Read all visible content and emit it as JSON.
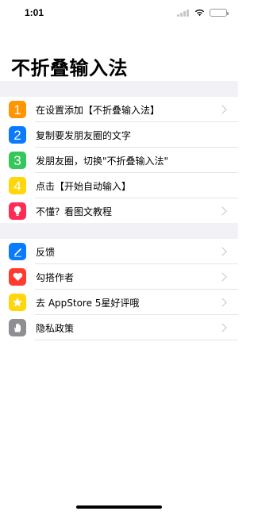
{
  "status": {
    "time": "1:01"
  },
  "title": "不折叠输入法",
  "group1": [
    {
      "num": "1",
      "label": "在设置添加【不折叠输入法】",
      "color": "#ff9500",
      "chevron": true
    },
    {
      "num": "2",
      "label": "复制要发朋友圈的文字",
      "color": "#0a7aff",
      "chevron": false
    },
    {
      "num": "3",
      "label": "发朋友圈，切换\"不折叠输入法\"",
      "color": "#34c759",
      "chevron": false
    },
    {
      "num": "4",
      "label": "点击【开始自动输入】",
      "color": "#ffd60a",
      "chevron": false
    },
    {
      "icon": "lightbulb-icon",
      "label": "不懂？看图文教程",
      "color": "#ff2d55",
      "chevron": true
    }
  ],
  "group2": [
    {
      "icon": "pen-icon",
      "label": "反馈",
      "color": "#0a7aff",
      "chevron": true
    },
    {
      "icon": "heart-icon",
      "label": "勾搭作者",
      "color": "#ff3b30",
      "chevron": true
    },
    {
      "icon": "star-icon",
      "label": "去 AppStore 5星好评哦",
      "color": "#ffd60a",
      "chevron": true
    },
    {
      "icon": "hand-icon",
      "label": "隐私政策",
      "color": "#8e8e93",
      "chevron": true
    }
  ]
}
